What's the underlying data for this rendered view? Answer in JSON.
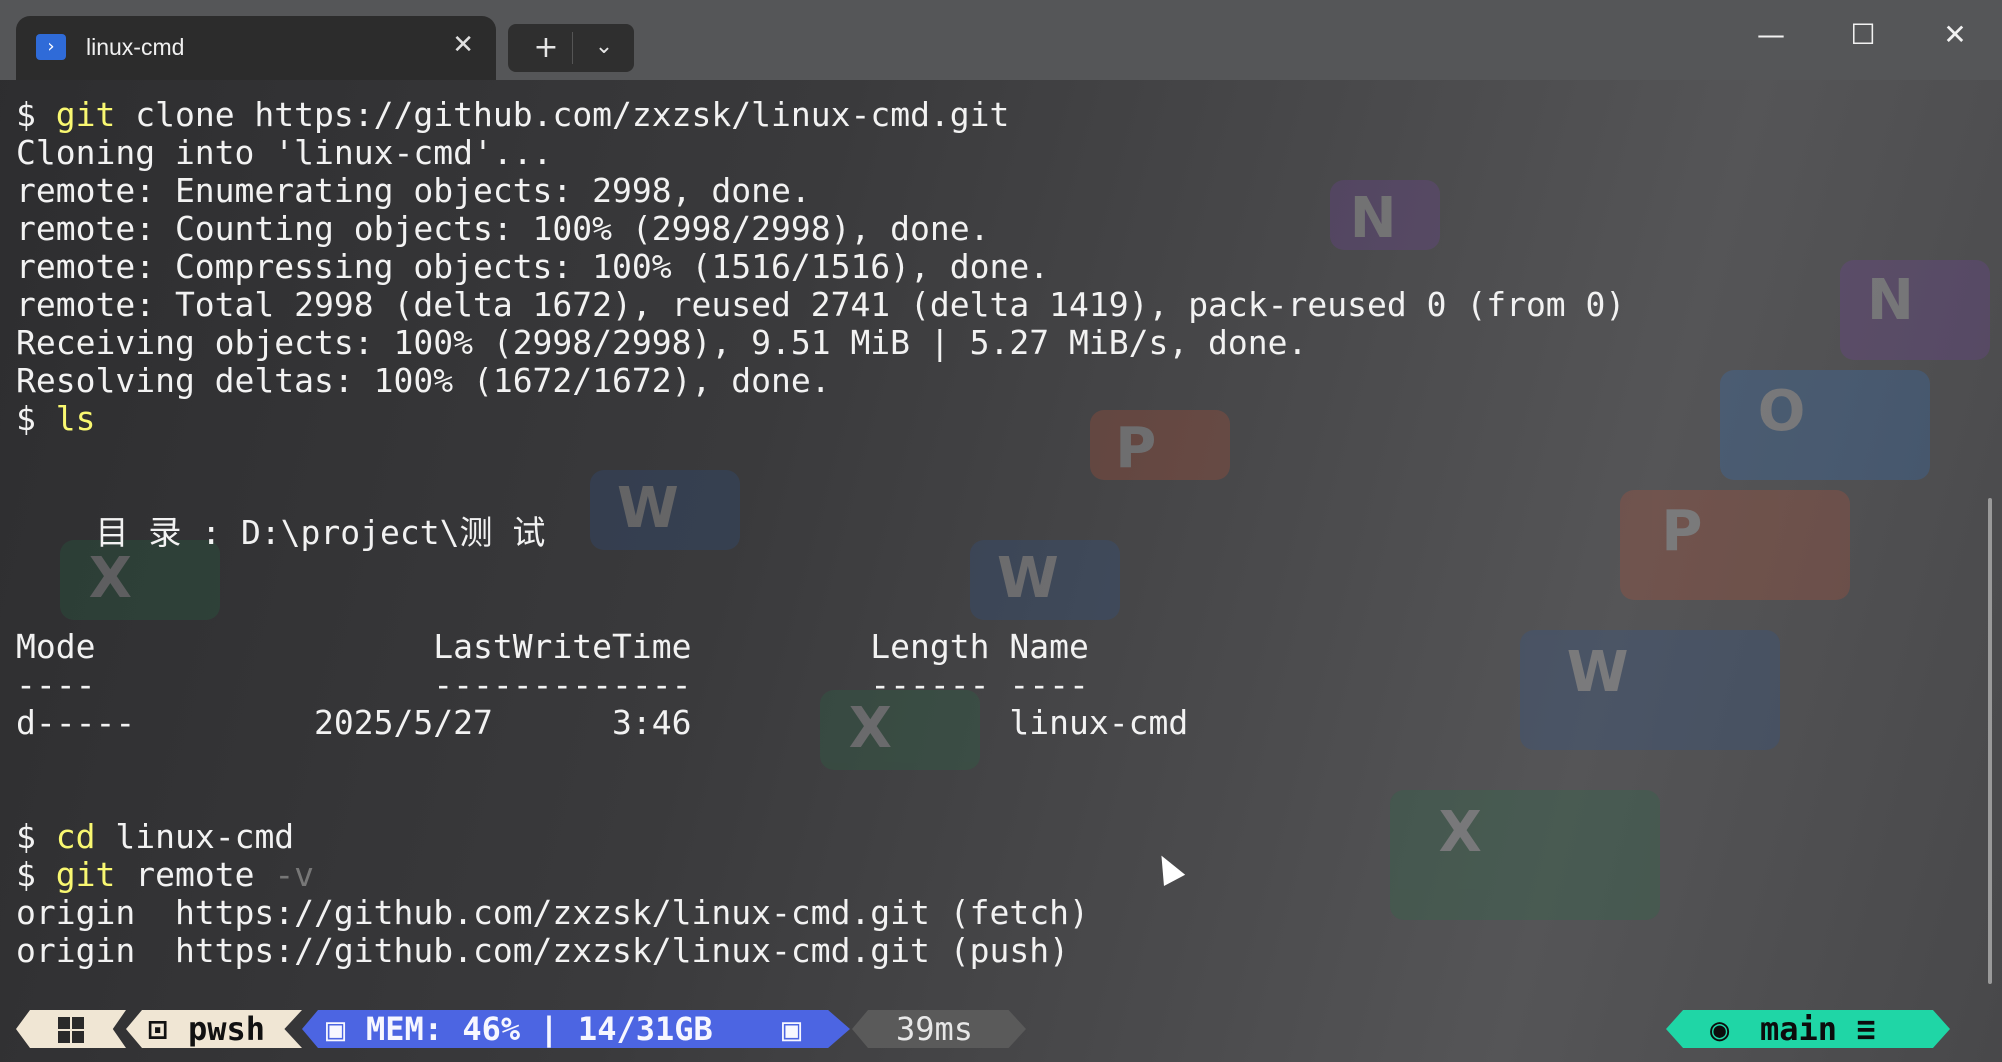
{
  "tab": {
    "title": "linux-cmd",
    "icon": "powershell-icon"
  },
  "window_controls": {
    "minimize": "—",
    "maximize": "☐",
    "close": "✕"
  },
  "new_tab": {
    "plus": "+",
    "chevron": "⌄"
  },
  "terminal": {
    "lines": [
      {
        "prompt": "$ ",
        "cmd": "git",
        "rest": " clone https://github.com/zxzsk/linux-cmd.git",
        "dim": ""
      },
      {
        "prompt": "",
        "cmd": "",
        "rest": "Cloning into 'linux-cmd'...",
        "dim": ""
      },
      {
        "prompt": "",
        "cmd": "",
        "rest": "remote: Enumerating objects: 2998, done.",
        "dim": ""
      },
      {
        "prompt": "",
        "cmd": "",
        "rest": "remote: Counting objects: 100% (2998/2998), done.",
        "dim": ""
      },
      {
        "prompt": "",
        "cmd": "",
        "rest": "remote: Compressing objects: 100% (1516/1516), done.",
        "dim": ""
      },
      {
        "prompt": "",
        "cmd": "",
        "rest": "remote: Total 2998 (delta 1672), reused 2741 (delta 1419), pack-reused 0 (from 0)",
        "dim": ""
      },
      {
        "prompt": "",
        "cmd": "",
        "rest": "Receiving objects: 100% (2998/2998), 9.51 MiB | 5.27 MiB/s, done.",
        "dim": ""
      },
      {
        "prompt": "",
        "cmd": "",
        "rest": "Resolving deltas: 100% (1672/1672), done.",
        "dim": ""
      },
      {
        "prompt": "$ ",
        "cmd": "ls",
        "rest": "",
        "dim": ""
      },
      {
        "prompt": "",
        "cmd": "",
        "rest": "",
        "dim": ""
      },
      {
        "prompt": "",
        "cmd": "",
        "rest": "",
        "dim": ""
      },
      {
        "prompt": "",
        "cmd": "",
        "rest": "    目 录 : D:\\project\\测 试",
        "dim": ""
      },
      {
        "prompt": "",
        "cmd": "",
        "rest": "",
        "dim": ""
      },
      {
        "prompt": "",
        "cmd": "",
        "rest": "",
        "dim": ""
      },
      {
        "prompt": "",
        "cmd": "",
        "rest": "Mode                 LastWriteTime         Length Name",
        "dim": ""
      },
      {
        "prompt": "",
        "cmd": "",
        "rest": "----                 -------------         ------ ----",
        "dim": ""
      },
      {
        "prompt": "",
        "cmd": "",
        "rest": "d-----         2025/5/27      3:46                linux-cmd",
        "dim": ""
      },
      {
        "prompt": "",
        "cmd": "",
        "rest": "",
        "dim": ""
      },
      {
        "prompt": "",
        "cmd": "",
        "rest": "",
        "dim": ""
      },
      {
        "prompt": "$ ",
        "cmd": "cd",
        "rest": " linux-cmd",
        "dim": ""
      },
      {
        "prompt": "$ ",
        "cmd": "git",
        "rest": " remote ",
        "dim": "-v"
      },
      {
        "prompt": "",
        "cmd": "",
        "rest": "origin  https://github.com/zxzsk/linux-cmd.git (fetch)",
        "dim": ""
      },
      {
        "prompt": "",
        "cmd": "",
        "rest": "origin  https://github.com/zxzsk/linux-cmd.git (push)",
        "dim": ""
      }
    ]
  },
  "status": {
    "shell": "pwsh",
    "mem": "MEM: 46% | 14/31GB",
    "time": "39ms",
    "branch": "main ≡"
  },
  "colors": {
    "command": "#f9f871",
    "mem_segment": "#4c65e2",
    "git_segment": "#1fd6a6",
    "shell_segment": "#f0e6d4"
  }
}
